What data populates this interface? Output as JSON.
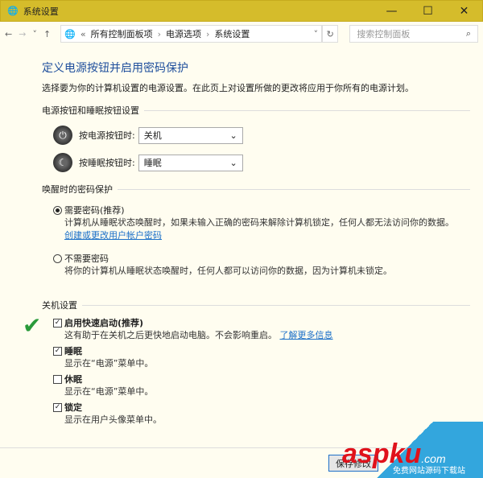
{
  "window": {
    "title": "系统设置",
    "min": "—",
    "max": "☐",
    "close": "✕"
  },
  "nav": {
    "back": "←",
    "forward": "→",
    "recent": "˅",
    "up": "↑",
    "crumb_prefix": "«",
    "crumbs": [
      "所有控制面板项",
      "电源选项",
      "系统设置"
    ],
    "sep": "›",
    "dropdown": "˅",
    "refresh": "↻",
    "search_placeholder": "搜索控制面板",
    "search_icon": "⌕"
  },
  "page": {
    "title": "定义电源按钮并启用密码保护",
    "subtitle": "选择要为你的计算机设置的电源设置。在此页上对设置所做的更改将应用于你所有的电源计划。"
  },
  "buttons_group": {
    "label": "电源按钮和睡眠按钮设置",
    "power_label": "按电源按钮时:",
    "power_value": "关机",
    "sleep_label": "按睡眠按钮时:",
    "sleep_value": "睡眠",
    "chevron": "⌄"
  },
  "password_group": {
    "label": "唤醒时的密码保护",
    "opt1": "需要密码(推荐)",
    "opt1_desc": "计算机从睡眠状态唤醒时，如果未输入正确的密码来解除计算机锁定，任何人都无法访问你的数据。",
    "opt1_link": "创建或更改用户帐户密码",
    "opt2": "不需要密码",
    "opt2_desc": "将你的计算机从睡眠状态唤醒时，任何人都可以访问你的数据，因为计算机未锁定。",
    "selected": "opt1"
  },
  "shutdown_group": {
    "label": "关机设置",
    "items": [
      {
        "label": "启用快速启动(推荐)",
        "desc": "这有助于在关机之后更快地启动电脑。不会影响重启。",
        "link": "了解更多信息",
        "checked": true
      },
      {
        "label": "睡眠",
        "desc": "显示在“电源”菜单中。",
        "checked": true
      },
      {
        "label": "休眠",
        "desc": "显示在“电源”菜单中。",
        "checked": false
      },
      {
        "label": "锁定",
        "desc": "显示在用户头像菜单中。",
        "checked": true
      }
    ]
  },
  "save_label": "保存修改",
  "watermark": {
    "brand": "aspku",
    "domain": ".com",
    "slogan": "免费网站源码下载站"
  }
}
